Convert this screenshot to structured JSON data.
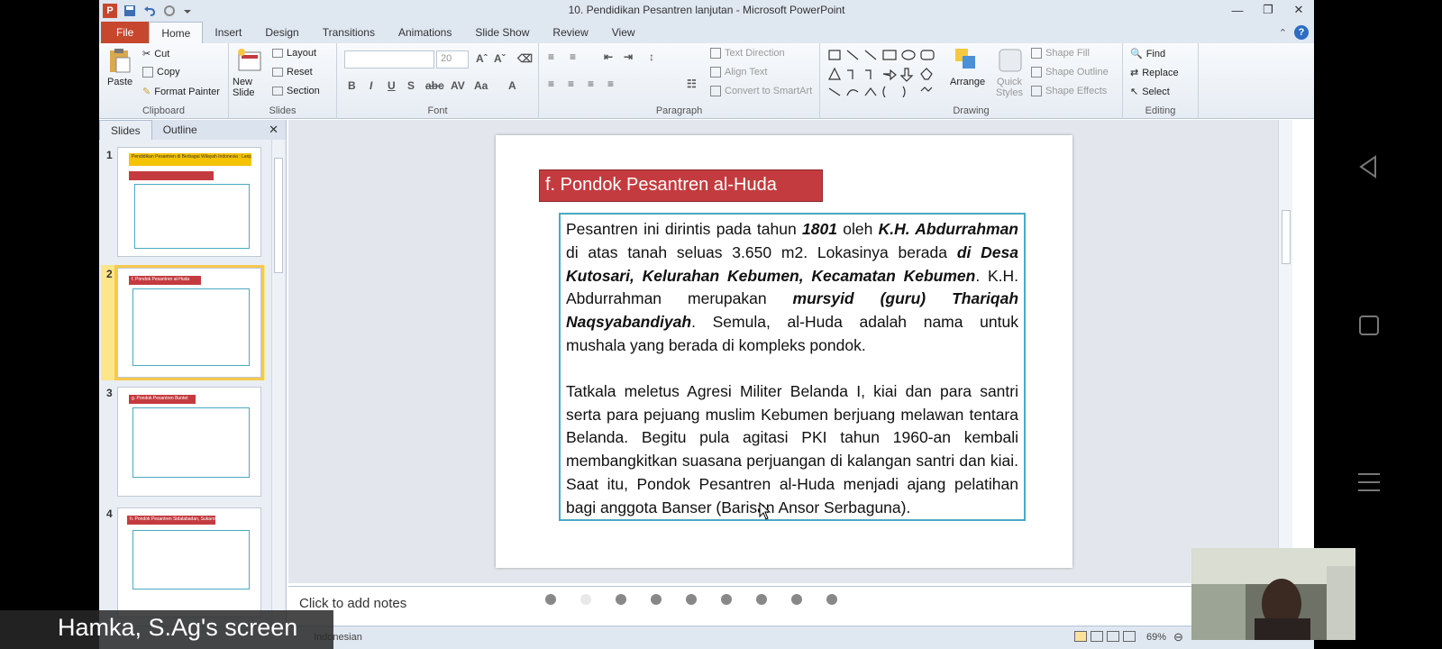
{
  "window": {
    "title": "10. Pendidikan Pesantren lanjutan - Microsoft PowerPoint"
  },
  "tabs": [
    "File",
    "Home",
    "Insert",
    "Design",
    "Transitions",
    "Animations",
    "Slide Show",
    "Review",
    "View"
  ],
  "ribbon": {
    "clipboard": {
      "paste": "Paste",
      "cut": "Cut",
      "copy": "Copy",
      "format_painter": "Format Painter",
      "label": "Clipboard"
    },
    "slides": {
      "new_slide": "New Slide",
      "layout": "Layout",
      "reset": "Reset",
      "section": "Section",
      "label": "Slides"
    },
    "font": {
      "font_size": "20",
      "label": "Font"
    },
    "paragraph": {
      "text_direction": "Text Direction",
      "align_text": "Align Text",
      "convert": "Convert to SmartArt",
      "label": "Paragraph"
    },
    "drawing": {
      "arrange": "Arrange",
      "quick_styles": "Quick Styles",
      "shape_fill": "Shape Fill",
      "shape_outline": "Shape Outline",
      "shape_effects": "Shape Effects",
      "label": "Drawing"
    },
    "editing": {
      "find": "Find",
      "replace": "Replace",
      "select": "Select",
      "label": "Editing"
    }
  },
  "panel": {
    "tabs": [
      "Slides",
      "Outline"
    ],
    "slide_numbers": [
      "1",
      "2",
      "3",
      "4"
    ],
    "thumb_titles": [
      "Pendidikan Pesantren di Berbagai Wilayah Indonesia : Lanjutan",
      "f. Pondok Pesantren al-Huda",
      "g. Pondok Pesantren Buntet",
      "h. Pondok Pesantren Sidalabadan, Sukaroto"
    ]
  },
  "slide": {
    "title": "f. Pondok Pesantren al-Huda",
    "p1_a": "Pesantren ini dirintis pada tahun ",
    "p1_b": "1801",
    "p1_c": " oleh ",
    "p1_d": "K.H. Abdurrahman",
    "p1_e": " di atas tanah seluas 3.650 m2. Lokasinya berada ",
    "p1_f": "di Desa Kutosari, Kelurahan Kebumen, Kecamatan Kebumen",
    "p1_g": ". K.H. Abdurrahman merupakan ",
    "p1_h": "mursyid (guru) Thariqah Naqsyabandiyah",
    "p1_i": ". Semula, al-Huda adalah nama untuk mushala yang berada di kompleks pondok.",
    "p2": "Tatkala meletus Agresi Militer Belanda I, kiai dan para santri serta para pejuang muslim Kebumen berjuang melawan tentara Belanda. Begitu pula agitasi PKI tahun 1960-an kembali membangkitkan suasana perjuangan di kalangan santri dan kiai. Saat itu, Pondok Pesantren al-Huda menjadi ajang pelatihan bagi anggota Banser (Barisan Ansor Serbaguna)."
  },
  "notes": {
    "placeholder": "Click to add notes"
  },
  "status": {
    "language": "Indonesian",
    "zoom": "69%"
  },
  "overlay": {
    "screen_label": "Hamka, S.Ag's screen"
  }
}
